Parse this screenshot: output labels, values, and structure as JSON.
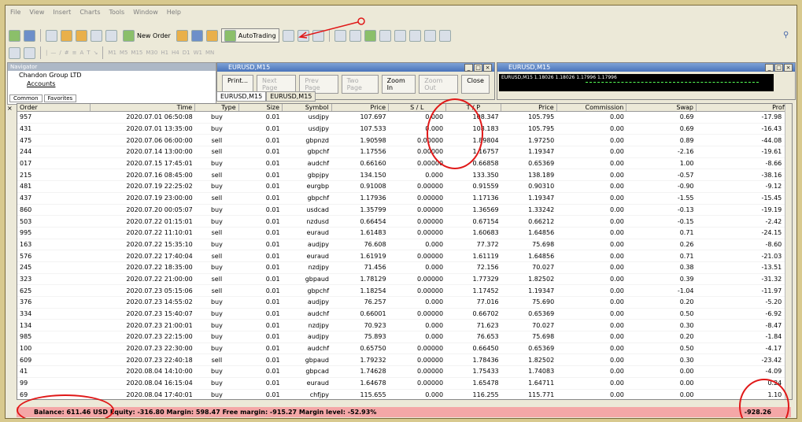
{
  "menu": [
    "File",
    "View",
    "Insert",
    "Charts",
    "Tools",
    "Window",
    "Help"
  ],
  "toolbar": {
    "new_order": "New Order",
    "autotrading": "AutoTrading",
    "timeframes": [
      "M1",
      "M5",
      "M15",
      "M30",
      "H1",
      "H4",
      "D1",
      "W1",
      "MN"
    ]
  },
  "navigator": {
    "title": "Navigator",
    "items": [
      "Chandon Group LTD",
      "Accounts"
    ],
    "tabs": [
      "Common",
      "Favorites"
    ]
  },
  "chart1": {
    "title": "EURUSD,M15",
    "buttons": [
      "Print...",
      "Next Page",
      "Prev Page",
      "Two Page",
      "Zoom In",
      "Zoom Out",
      "Close"
    ]
  },
  "chart2": {
    "title": "EURUSD,M15",
    "info": "EURUSD,M15 1.18026 1.18026 1.17996 1.17996"
  },
  "chart_tabs": [
    "EURUSD,M15",
    "EURUSD,M15"
  ],
  "columns": [
    "Order",
    "Time",
    "Type",
    "Size",
    "Symbol",
    "Price",
    "S / L",
    "T / P",
    "Price",
    "Commission",
    "Swap",
    "Profit"
  ],
  "rows": [
    [
      "957",
      "2020.07.01 06:50:08",
      "buy",
      "0.01",
      "usdjpy",
      "107.697",
      "0.000",
      "108.347",
      "105.795",
      "0.00",
      "0.69",
      "-17.98"
    ],
    [
      "431",
      "2020.07.01 13:35:00",
      "buy",
      "0.01",
      "usdjpy",
      "107.533",
      "0.000",
      "108.183",
      "105.795",
      "0.00",
      "0.69",
      "-16.43"
    ],
    [
      "475",
      "2020.07.06 06:00:00",
      "sell",
      "0.01",
      "gbpnzd",
      "1.90598",
      "0.00000",
      "1.89804",
      "1.97250",
      "0.00",
      "0.89",
      "-44.08"
    ],
    [
      "244",
      "2020.07.14 13:00:00",
      "sell",
      "0.01",
      "gbpchf",
      "1.17556",
      "0.00000",
      "1.16757",
      "1.19347",
      "0.00",
      "-2.16",
      "-19.61"
    ],
    [
      "017",
      "2020.07.15 17:45:01",
      "buy",
      "0.01",
      "audchf",
      "0.66160",
      "0.00000",
      "0.66858",
      "0.65369",
      "0.00",
      "1.00",
      "-8.66"
    ],
    [
      "215",
      "2020.07.16 08:45:00",
      "sell",
      "0.01",
      "gbpjpy",
      "134.150",
      "0.000",
      "133.350",
      "138.189",
      "0.00",
      "-0.57",
      "-38.16"
    ],
    [
      "481",
      "2020.07.19 22:25:02",
      "buy",
      "0.01",
      "eurgbp",
      "0.91008",
      "0.00000",
      "0.91559",
      "0.90310",
      "0.00",
      "-0.90",
      "-9.12"
    ],
    [
      "437",
      "2020.07.19 23:00:00",
      "sell",
      "0.01",
      "gbpchf",
      "1.17936",
      "0.00000",
      "1.17136",
      "1.19347",
      "0.00",
      "-1.55",
      "-15.45"
    ],
    [
      "860",
      "2020.07.20 00:05:07",
      "buy",
      "0.01",
      "usdcad",
      "1.35799",
      "0.00000",
      "1.36569",
      "1.33242",
      "0.00",
      "-0.13",
      "-19.19"
    ],
    [
      "503",
      "2020.07.22 01:15:01",
      "buy",
      "0.01",
      "nzdusd",
      "0.66454",
      "0.00000",
      "0.67154",
      "0.66212",
      "0.00",
      "-0.15",
      "-2.42"
    ],
    [
      "995",
      "2020.07.22 11:10:01",
      "sell",
      "0.01",
      "euraud",
      "1.61483",
      "0.00000",
      "1.60683",
      "1.64856",
      "0.00",
      "0.71",
      "-24.15"
    ],
    [
      "163",
      "2020.07.22 15:35:10",
      "buy",
      "0.01",
      "audjpy",
      "76.608",
      "0.000",
      "77.372",
      "75.698",
      "0.00",
      "0.26",
      "-8.60"
    ],
    [
      "576",
      "2020.07.22 17:40:04",
      "sell",
      "0.01",
      "euraud",
      "1.61919",
      "0.00000",
      "1.61119",
      "1.64856",
      "0.00",
      "0.71",
      "-21.03"
    ],
    [
      "245",
      "2020.07.22 18:35:00",
      "buy",
      "0.01",
      "nzdjpy",
      "71.456",
      "0.000",
      "72.156",
      "70.027",
      "0.00",
      "0.38",
      "-13.51"
    ],
    [
      "323",
      "2020.07.22 21:00:00",
      "sell",
      "0.01",
      "gbpaud",
      "1.78129",
      "0.00000",
      "1.77329",
      "1.82502",
      "0.00",
      "0.39",
      "-31.32"
    ],
    [
      "625",
      "2020.07.23 05:15:06",
      "sell",
      "0.01",
      "gbpchf",
      "1.18254",
      "0.00000",
      "1.17452",
      "1.19347",
      "0.00",
      "-1.04",
      "-11.97"
    ],
    [
      "376",
      "2020.07.23 14:55:02",
      "buy",
      "0.01",
      "audjpy",
      "76.257",
      "0.000",
      "77.016",
      "75.690",
      "0.00",
      "0.20",
      "-5.20"
    ],
    [
      "334",
      "2020.07.23 15:40:07",
      "buy",
      "0.01",
      "audchf",
      "0.66001",
      "0.00000",
      "0.66702",
      "0.65369",
      "0.00",
      "0.50",
      "-6.92"
    ],
    [
      "134",
      "2020.07.23 21:00:01",
      "buy",
      "0.01",
      "nzdjpy",
      "70.923",
      "0.000",
      "71.623",
      "70.027",
      "0.00",
      "0.30",
      "-8.47"
    ],
    [
      "985",
      "2020.07.23 22:15:00",
      "buy",
      "0.01",
      "audjpy",
      "75.893",
      "0.000",
      "76.653",
      "75.698",
      "0.00",
      "0.20",
      "-1.84"
    ],
    [
      "100",
      "2020.07.23 22:30:00",
      "buy",
      "0.01",
      "audchf",
      "0.65750",
      "0.00000",
      "0.66450",
      "0.65369",
      "0.00",
      "0.50",
      "-4.17"
    ],
    [
      "609",
      "2020.07.23 22:40:18",
      "sell",
      "0.01",
      "gbpaud",
      "1.79232",
      "0.00000",
      "1.78436",
      "1.82502",
      "0.00",
      "0.30",
      "-23.42"
    ],
    [
      "41",
      "2020.08.04 14:10:00",
      "buy",
      "0.01",
      "gbpcad",
      "1.74628",
      "0.00000",
      "1.75433",
      "1.74083",
      "0.00",
      "0.00",
      "-4.09"
    ],
    [
      "99",
      "2020.08.04 16:15:04",
      "buy",
      "0.01",
      "euraud",
      "1.64678",
      "0.00000",
      "1.65478",
      "1.64711",
      "0.00",
      "0.00",
      "0.24"
    ],
    [
      "69",
      "2020.08.04 17:40:01",
      "buy",
      "0.01",
      "chfjpy",
      "115.655",
      "0.000",
      "116.255",
      "115.771",
      "0.00",
      "0.00",
      "1.10"
    ]
  ],
  "balance": {
    "text": "Balance: 611.46 USD  Equity: -316.80  Margin: 598.47  Free margin: -915.27  Margin level: -52.93%",
    "profit": "-928.26"
  },
  "colors": {
    "balance_bg": "#f4a7a7",
    "annotation": "#e01818"
  }
}
